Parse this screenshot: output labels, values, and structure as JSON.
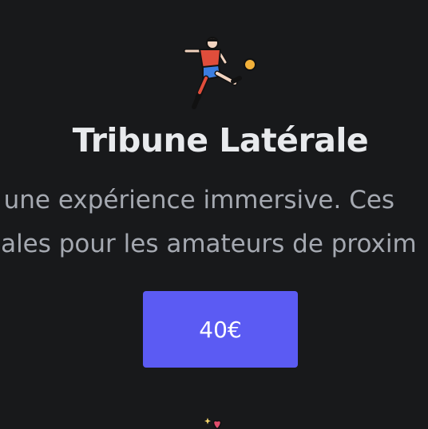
{
  "card": {
    "icon": "football-player-icon",
    "title": "Tribune Latérale",
    "description_lines": [
      "r une expérience immersive. Ces",
      "éales pour les amateurs de proxim"
    ],
    "price_label": "40€"
  },
  "next_card": {
    "icon": "sparkle-heart-icon"
  },
  "colors": {
    "background": "#18191b",
    "title": "#e8eaed",
    "description": "#a5a9b1",
    "button": "#5b5bf3",
    "button_text": "#ffffff"
  }
}
